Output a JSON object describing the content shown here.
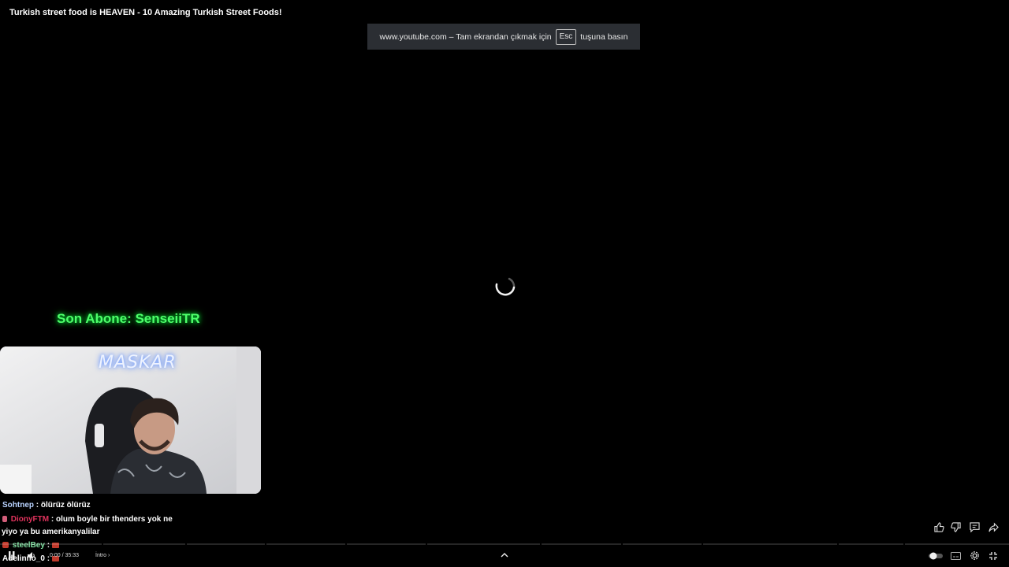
{
  "video": {
    "title": "Turkish street food is HEAVEN - 10 Amazing Turkish Street Foods!",
    "time_display": "0:00 / 35:33",
    "chapter": "İntro",
    "progress_fraction": 0.0
  },
  "fullscreen_notice": {
    "prefix": "www.youtube.com – Tam ekrandan çıkmak için",
    "key": "Esc",
    "suffix": "tuşuna basın"
  },
  "overlay": {
    "subscriber_banner": "Son Abone: SenseiiTR",
    "webcam_sign": "MASKAR"
  },
  "chat": {
    "messages": [
      {
        "user": "Sohtnep",
        "text": ": ölürüz ölürüz",
        "color": "#b9d3ff"
      },
      {
        "user": "DionyFTM",
        "text": ": olum boyle bir thenders yok ne",
        "continuation": "yiyo ya bu amerikanyalilar",
        "color": "#e0335d"
      },
      {
        "user": "steelBey",
        "text": ":",
        "color": "#7fe0a0"
      },
      {
        "user": "Adelinno_0",
        "text": ":",
        "color": "#ffffff"
      }
    ]
  },
  "controls": {
    "icons": [
      "play-pause-icon",
      "volume-icon",
      "chevron-up-icon",
      "autoplay-toggle-icon",
      "subtitles-icon",
      "settings-icon",
      "exit-fullscreen-icon"
    ]
  },
  "side_actions": {
    "icons": [
      "like-icon",
      "dislike-icon",
      "comment-icon",
      "share-icon"
    ]
  },
  "colors": {
    "banner_green": "#4dff6a",
    "notice_bg": "#2b2e33",
    "background": "#000000"
  }
}
